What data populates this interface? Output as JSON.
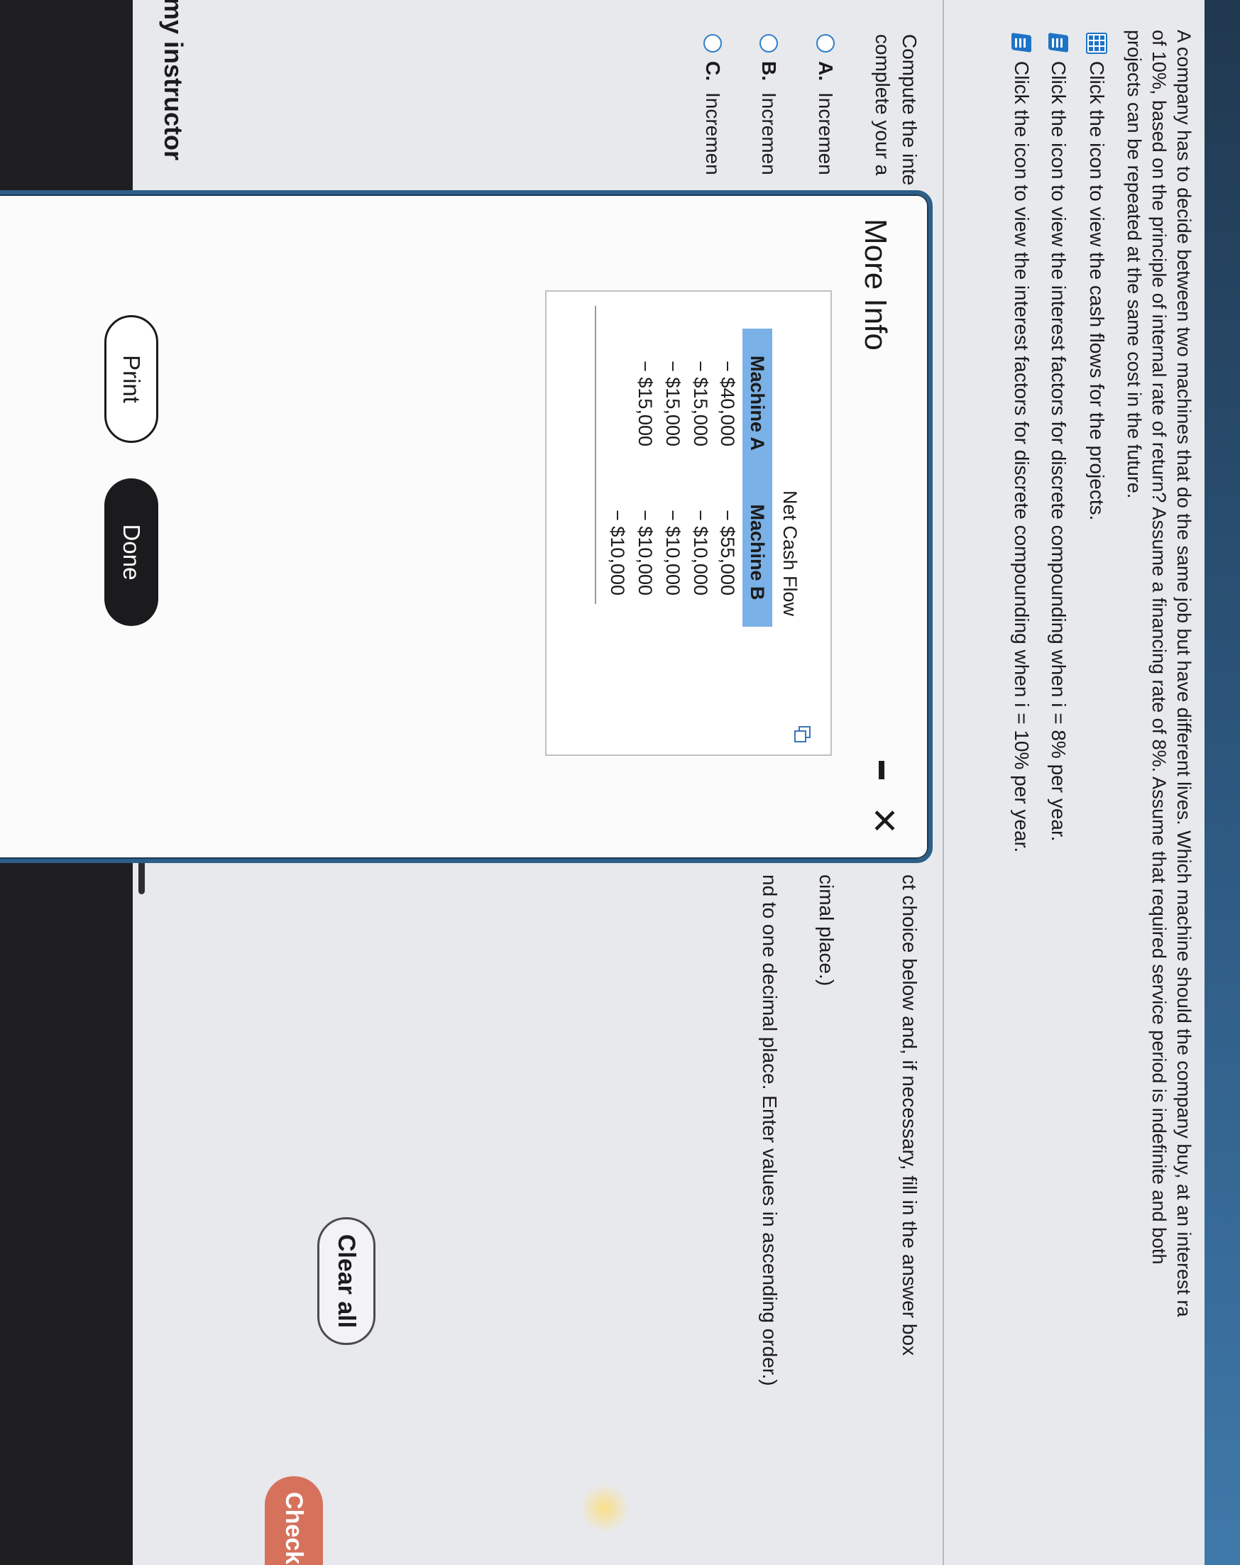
{
  "question": {
    "lines": [
      "A company has to decide between two machines that do the same job but have different lives. Which machine should the company buy, at an interest ra",
      "of 10%, based on the principle of internal rate of return? Assume a financing rate of 8%. Assume that required service period is indefinite and both",
      "projects can be repeated at the same cost in the future."
    ]
  },
  "info_links": [
    {
      "icon": "grid-icon",
      "label": "Click the icon to view the cash flows for the projects."
    },
    {
      "icon": "document-icon",
      "label": "Click the icon to view the interest factors for discrete compounding when i = 8% per year."
    },
    {
      "icon": "document-icon",
      "label": "Click the icon to view the interest factors for discrete compounding when i = 10% per year."
    }
  ],
  "instructions": {
    "left_line1": "Compute the inte",
    "left_line2": "complete your a",
    "right_line1": "ct choice below and, if necessary, fill in the answer box",
    "right_line2": "cimal place.)",
    "right_line3": "nd to one decimal place. Enter values in ascending order.)"
  },
  "options": [
    {
      "letter": "A.",
      "text": "Incremen"
    },
    {
      "letter": "B.",
      "text": "Incremen"
    },
    {
      "letter": "C.",
      "text": "Incremen"
    }
  ],
  "modal": {
    "title": "More Info",
    "table_caption": "Net Cash Flow",
    "columns": [
      "Machine A",
      "Machine B"
    ],
    "machine_a": [
      "− $40,000",
      "− $15,000",
      "− $15,000",
      "− $15,000"
    ],
    "machine_b": [
      "− $55,000",
      "− $10,000",
      "− $10,000",
      "− $10,000",
      "− $10,000"
    ],
    "print_label": "Print",
    "done_label": "Done"
  },
  "buttons": {
    "clear_all": "Clear all",
    "check": "Check"
  },
  "footer": {
    "instructor": "my instructor"
  },
  "colors": {
    "accent": "#1f73c6",
    "header_bg": "#7ab1e6",
    "modal_border": "#2b5f88",
    "check_button": "#d6725c"
  }
}
